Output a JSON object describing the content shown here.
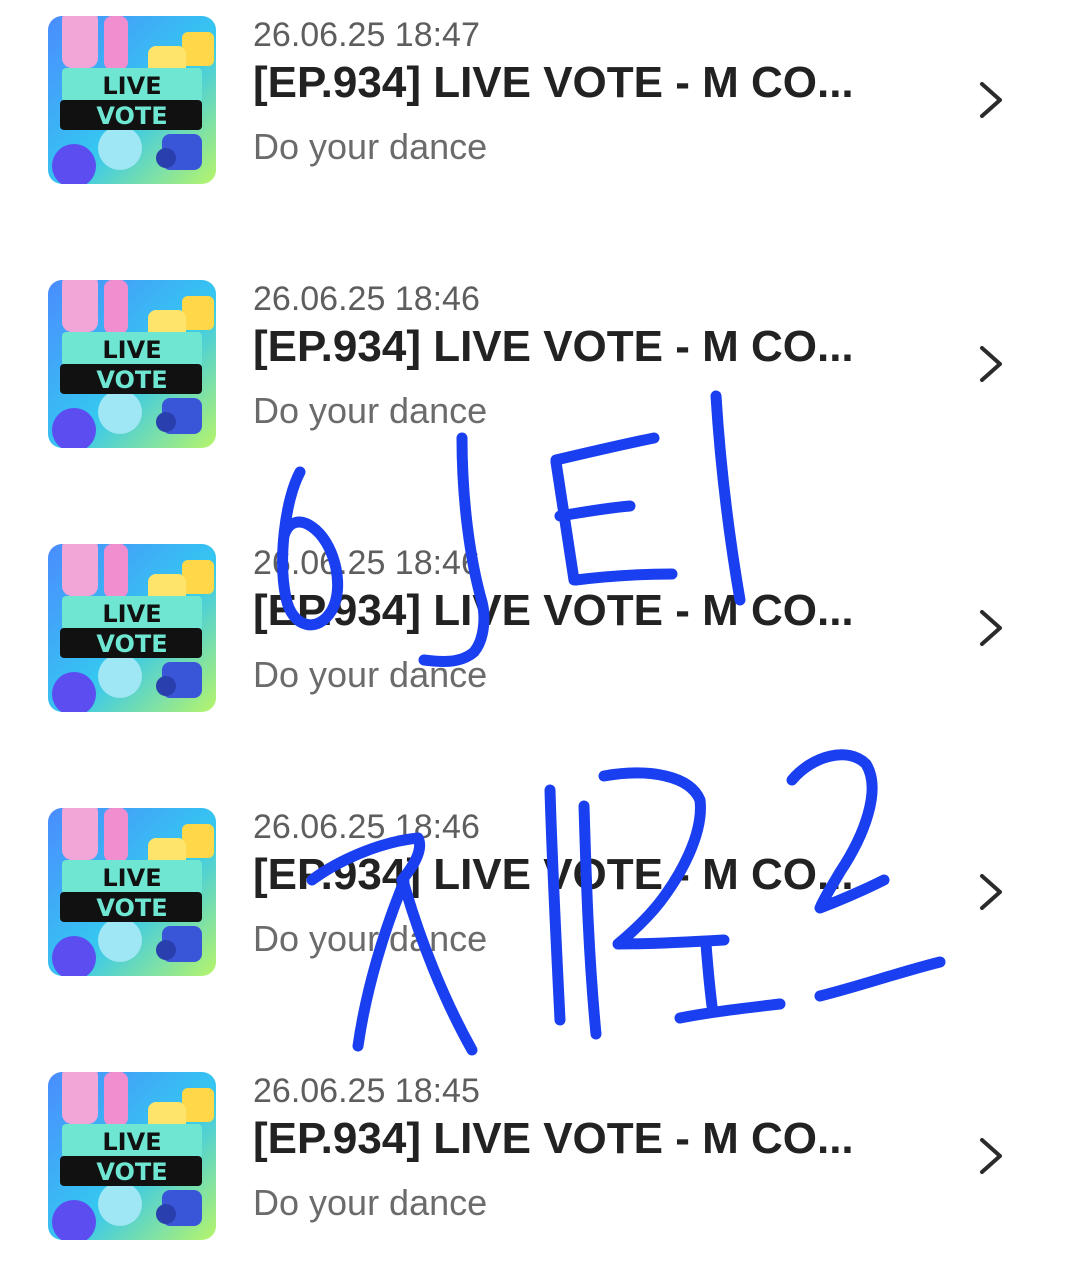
{
  "colors": {
    "date_text": "#5e5e5e",
    "title_text": "#222222",
    "subtitle_text": "#6b6b6b",
    "chevron": "#2b2b2b",
    "thumb_badge_bg": "#6ee6d2",
    "thumb_badge_band": "#111111",
    "thumb_sky": "#3ba6ff",
    "annotation_ink": "#1a3ff0"
  },
  "thumbnail": {
    "line1": "LIVE",
    "line2": "VOTE"
  },
  "items": [
    {
      "date": "26.06.25 18:47",
      "title": "[EP.934] LIVE VOTE - M CO...",
      "subtitle": "Do your dance",
      "icon": "chevron-right-icon"
    },
    {
      "date": "26.06.25 18:46",
      "title": "[EP.934] LIVE VOTE - M CO...",
      "subtitle": "Do your dance",
      "icon": "chevron-right-icon"
    },
    {
      "date": "26.06.25 18:46",
      "title": "[EP.934] LIVE VOTE - M CO...",
      "subtitle": "Do your dance",
      "icon": "chevron-right-icon"
    },
    {
      "date": "26.06.25 18:46",
      "title": "[EP.934] LIVE VOTE - M CO...",
      "subtitle": "Do your dance",
      "icon": "chevron-right-icon"
    },
    {
      "date": "26.06.25 18:45",
      "title": "[EP.934] LIVE VOTE - M CO...",
      "subtitle": "Do your dance",
      "icon": "chevron-right-icon"
    }
  ]
}
